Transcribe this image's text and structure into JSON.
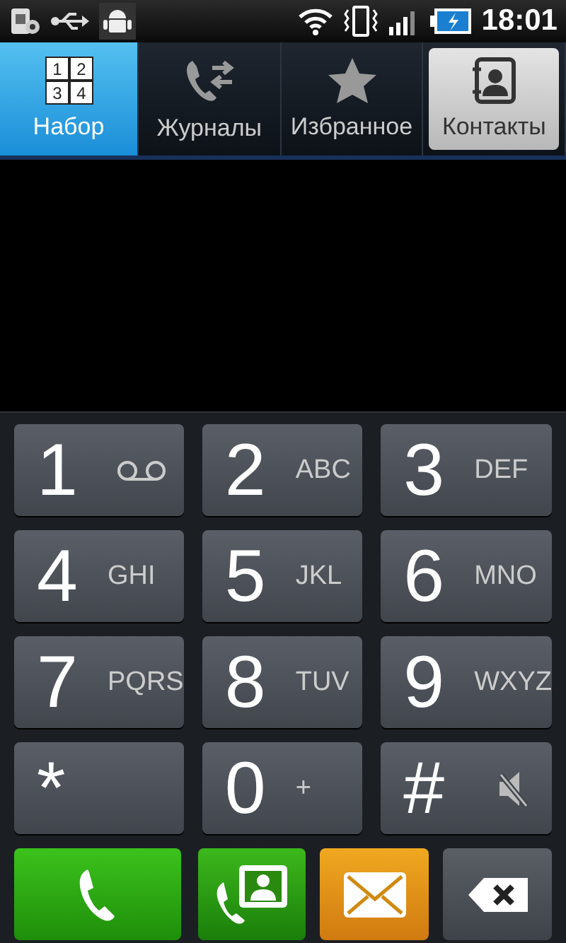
{
  "status_bar": {
    "time": "18:01"
  },
  "tabs": [
    {
      "label": "Набор",
      "kind": "keypad",
      "icon_digits": [
        "1",
        "2",
        "3",
        "4"
      ],
      "selected": true,
      "focused": false
    },
    {
      "label": "Журналы",
      "kind": "log",
      "selected": false,
      "focused": false
    },
    {
      "label": "Избранное",
      "kind": "star",
      "selected": false,
      "focused": false
    },
    {
      "label": "Контакты",
      "kind": "contacts",
      "selected": false,
      "focused": true
    }
  ],
  "keypad": {
    "keys": [
      {
        "kind": "voicemail",
        "digit": "1"
      },
      {
        "kind": "letters",
        "digit": "2",
        "letters": "ABC"
      },
      {
        "kind": "letters",
        "digit": "3",
        "letters": "DEF"
      },
      {
        "kind": "letters",
        "digit": "4",
        "letters": "GHI"
      },
      {
        "kind": "letters",
        "digit": "5",
        "letters": "JKL"
      },
      {
        "kind": "letters",
        "digit": "6",
        "letters": "MNO"
      },
      {
        "kind": "letters",
        "digit": "7",
        "letters": "PQRS"
      },
      {
        "kind": "letters",
        "digit": "8",
        "letters": "TUV"
      },
      {
        "kind": "letters",
        "digit": "9",
        "letters": "WXYZ"
      },
      {
        "kind": "plain",
        "digit": "*"
      },
      {
        "kind": "letters",
        "digit": "0",
        "letters": "+"
      },
      {
        "kind": "mute",
        "digit": "#"
      }
    ],
    "actions": [
      {
        "kind": "call"
      },
      {
        "kind": "contact-call"
      },
      {
        "kind": "message"
      },
      {
        "kind": "delete"
      }
    ]
  }
}
